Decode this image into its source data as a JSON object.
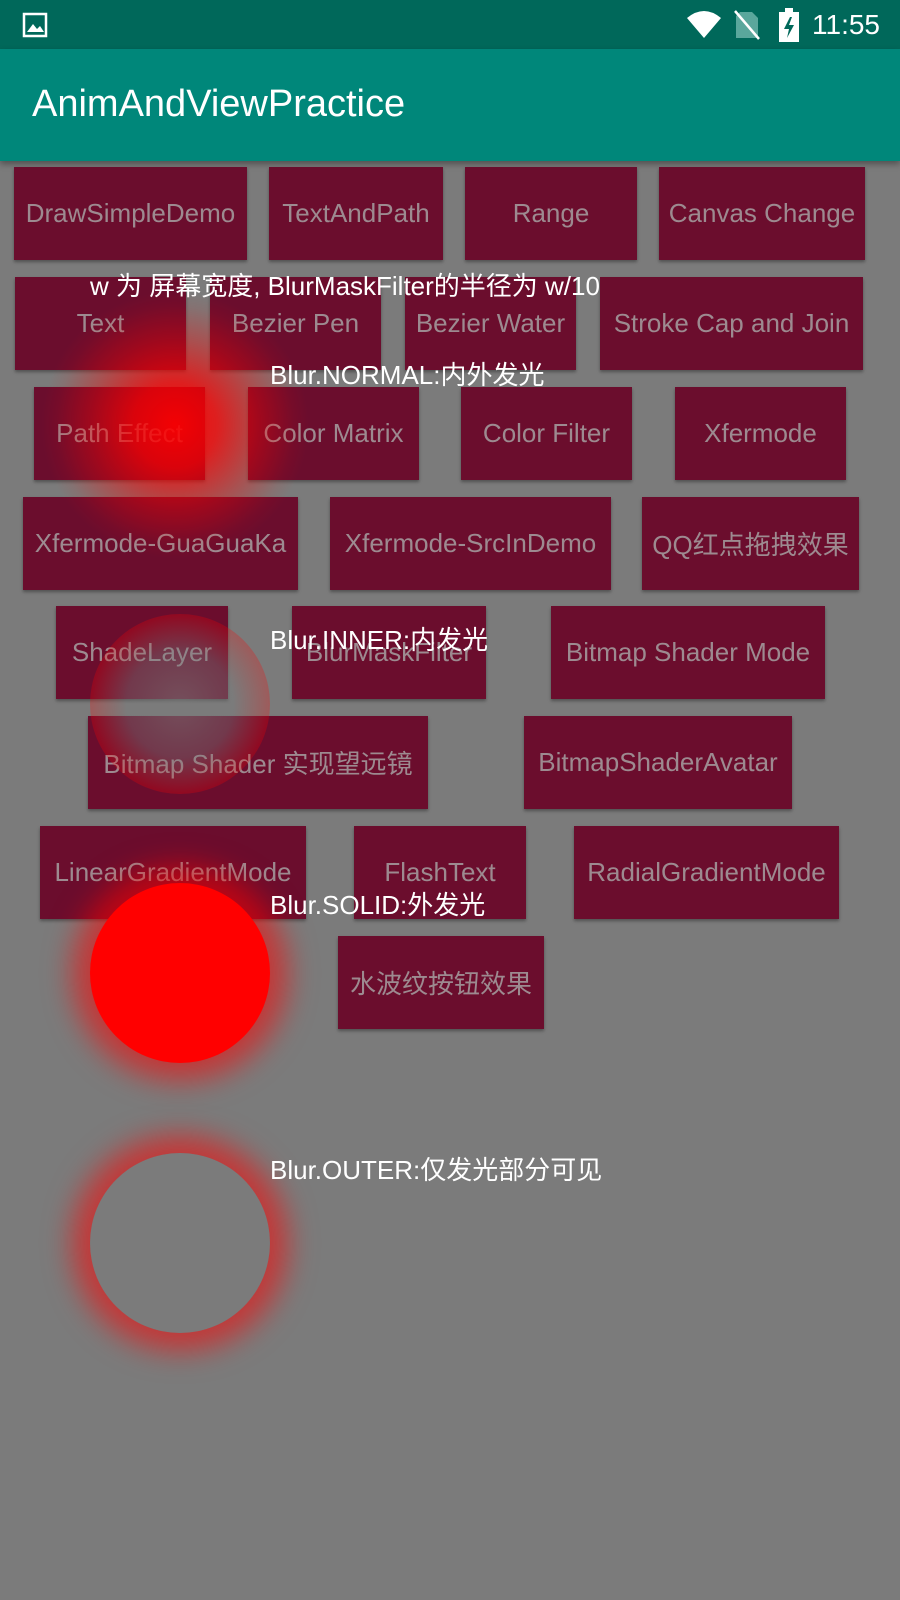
{
  "status_bar": {
    "time": "11:55",
    "icons": [
      "image-icon",
      "wifi-icon",
      "no-sim-icon",
      "battery-charging-icon"
    ]
  },
  "app_bar": {
    "title": "AnimAndViewPractice"
  },
  "buttons": [
    "DrawSimpleDemo",
    "TextAndPath",
    "Range",
    "Canvas Change",
    "Text",
    "Bezier Pen",
    "Bezier Water",
    "Stroke Cap and Join",
    "Path Effect",
    "Color Matrix",
    "Color Filter",
    "Xfermode",
    "Xfermode-GuaGuaKa",
    "Xfermode-SrcInDemo",
    "QQ红点拖拽效果",
    "ShadeLayer",
    "BlurMaskFilter",
    "Bitmap Shader Mode",
    "Bitmap Shader 实现望远镜",
    "BitmapShaderAvatar",
    "LinearGradientMode",
    "FlashText",
    "RadialGradientMode",
    "水波纹按钮效果"
  ],
  "overlay": {
    "heading": "w 为 屏幕宽度, BlurMaskFilter的半径为 w/10",
    "normal": "Blur.NORMAL:内外发光",
    "inner": "Blur.INNER:内发光",
    "solid": "Blur.SOLID:外发光",
    "outer": "Blur.OUTER:仅发光部分可见"
  },
  "colors": {
    "status_bar": "#00685a",
    "app_bar": "#00877a",
    "background": "#7b7b7b",
    "button": "#6b0d2d",
    "button_text": "#9d8a90",
    "glow": "#ff0000"
  }
}
